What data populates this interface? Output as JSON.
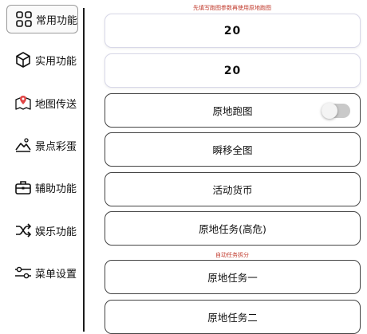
{
  "sidebar": {
    "items": [
      {
        "label": "常用功能",
        "icon": "grid-icon",
        "active": true
      },
      {
        "label": "实用功能",
        "icon": "cube-icon",
        "active": false
      },
      {
        "label": "地图传送",
        "icon": "map-pin-icon",
        "active": false
      },
      {
        "label": "景点彩蛋",
        "icon": "landscape-icon",
        "active": false
      },
      {
        "label": "辅助功能",
        "icon": "toolbox-icon",
        "active": false
      },
      {
        "label": "娱乐功能",
        "icon": "shuffle-icon",
        "active": false
      },
      {
        "label": "菜单设置",
        "icon": "sliders-icon",
        "active": false
      }
    ]
  },
  "main": {
    "hint_top": "先填写跑图参数再使用原地跑图",
    "input1_value": "20",
    "input2_value": "20",
    "run_in_place_label": "原地跑图",
    "run_in_place_toggle_on": false,
    "teleport_label": "瞬移全图",
    "currency_label": "活动货币",
    "task_high_label": "原地任务(高危)",
    "hint_split": "自动任务拆分",
    "task_one_label": "原地任务一",
    "task_two_label": "原地任务二"
  },
  "colors": {
    "hint_red": "#c0392b",
    "toggle_off": "#c9c9c9"
  }
}
